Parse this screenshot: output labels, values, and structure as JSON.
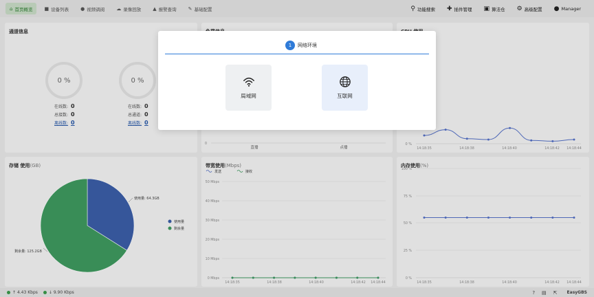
{
  "nav": {
    "items": [
      {
        "label": "首页概览",
        "icon": "home-icon",
        "active": true
      },
      {
        "label": "设备列表",
        "icon": "video-camera-icon"
      },
      {
        "label": "视频调阅",
        "icon": "play-circle-icon"
      },
      {
        "label": "录像回放",
        "icon": "cloud-icon"
      },
      {
        "label": "报警查询",
        "icon": "alarm-icon"
      },
      {
        "label": "基础配置",
        "icon": "edit-icon"
      }
    ],
    "right": [
      {
        "label": "功能搜索",
        "icon": "search-icon"
      },
      {
        "label": "插件管理",
        "icon": "puzzle-icon"
      },
      {
        "label": "算法仓",
        "icon": "gift-icon"
      },
      {
        "label": "高级配置",
        "icon": "gear-icon"
      },
      {
        "label": "Manager",
        "icon": "user-icon"
      }
    ]
  },
  "channels": {
    "title": "通道信息",
    "left": {
      "percent": "0 %",
      "online_label": "在线数:",
      "online": "0",
      "total_label": "总接数:",
      "total": "0",
      "offline_label": "离线数:",
      "offline": "0"
    },
    "right": {
      "percent": "0 %",
      "online_label": "在线数:",
      "online": "0",
      "total_label": "总通道:",
      "total": "0",
      "offline_label": "离线数:",
      "offline": "0"
    }
  },
  "load": {
    "title": "负载信息",
    "categories": [
      "直播",
      "点播"
    ],
    "y_tick": "0"
  },
  "cpu": {
    "title": "CPU 使用",
    "x_labels": [
      "14:18:35",
      "14:18:38",
      "14:18:40",
      "14:18:42",
      "14:18:44"
    ],
    "y_tick": "0 %"
  },
  "storage": {
    "title": "存储 使用",
    "unit": "(GB)",
    "used_label": "使用量: 64.3GB",
    "free_label": "剩余量: 125.2GB",
    "legend_used": "使用量",
    "legend_free": "剩余量"
  },
  "bandwidth": {
    "title": "带宽使用",
    "unit": "(Mbps)",
    "legend_send": "发送",
    "legend_recv": "接收",
    "y_ticks": [
      "50 Mbps",
      "40 Mbps",
      "30 Mbps",
      "20 Mbps",
      "10 Mbps",
      "0 Mbps"
    ],
    "x_labels": [
      "14:18:35",
      "14:18:38",
      "14:18:40",
      "14:18:42",
      "14:18:44"
    ]
  },
  "memory": {
    "title": "内存使用",
    "unit": "(%)",
    "y_ticks": [
      "100 %",
      "75 %",
      "50 %",
      "25 %",
      "0 %"
    ],
    "x_labels": [
      "14:18:35",
      "14:18:38",
      "14:18:40",
      "14:18:42",
      "14:18:44"
    ]
  },
  "status": {
    "up": "4.43 Kbps",
    "down": "9.90 Kbps",
    "brand": "EasyGBS"
  },
  "modal": {
    "step_num": "1",
    "step_label": "网络环境",
    "opt_lan": "局域网",
    "opt_internet": "互联网"
  },
  "colors": {
    "accent": "#2f7bd8",
    "used": "#3b5ea8",
    "free": "#3e9a5f",
    "line": "#5470c6"
  },
  "chart_data": [
    {
      "type": "pie",
      "title": "存储 使用",
      "categories": [
        "使用量",
        "剩余量"
      ],
      "values": [
        64.3,
        125.2
      ]
    },
    {
      "type": "line",
      "title": "CPU 使用",
      "x": [
        "14:18:35",
        "14:18:38",
        "14:18:40",
        "14:18:42",
        "14:18:44"
      ],
      "series": [
        {
          "values": [
            1.0,
            1.7,
            0.6,
            0.5,
            1.9,
            0.4,
            0.3,
            0.5
          ]
        }
      ]
    },
    {
      "type": "line",
      "title": "内存使用",
      "ylim": [
        0,
        100
      ],
      "x": [
        "14:18:35",
        "14:18:38",
        "14:18:40",
        "14:18:42",
        "14:18:44"
      ],
      "series": [
        {
          "values": [
            55,
            55,
            55,
            55,
            55,
            55,
            55,
            55
          ]
        }
      ]
    },
    {
      "type": "line",
      "title": "带宽使用",
      "ylim": [
        0,
        50
      ],
      "x": [
        "14:18:35",
        "14:18:38",
        "14:18:40",
        "14:18:42",
        "14:18:44"
      ],
      "series": [
        {
          "name": "发送",
          "values": [
            0,
            0,
            0,
            0,
            0,
            0,
            0,
            0
          ]
        },
        {
          "name": "接收",
          "values": [
            0,
            0,
            0,
            0,
            0,
            0,
            0,
            0
          ]
        }
      ]
    }
  ]
}
